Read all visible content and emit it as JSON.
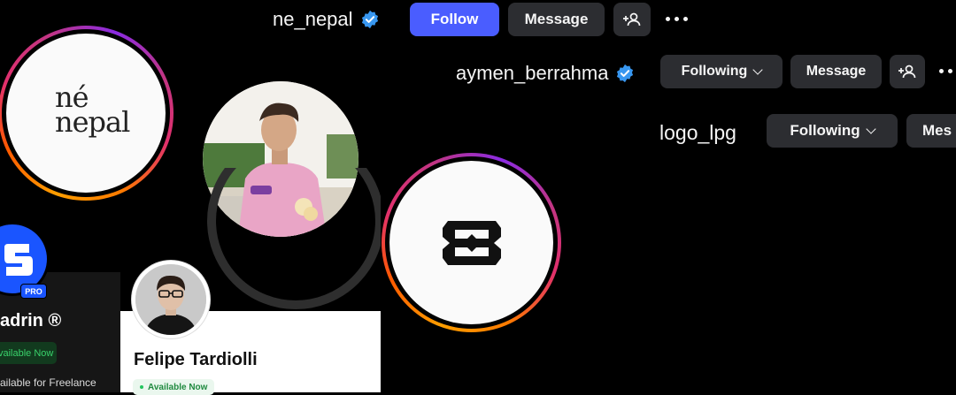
{
  "profile_ne_nepal": {
    "username": "ne_nepal",
    "follow_label": "Follow",
    "message_label": "Message",
    "logo_line1": "né",
    "logo_line2": "nepal"
  },
  "profile_aymen": {
    "username": "aymen_berrahma",
    "following_label": "Following",
    "message_label": "Message"
  },
  "profile_logo_lpg": {
    "username": "logo_lpg",
    "following_label": "Following",
    "message_label": "Mes"
  },
  "card_left": {
    "badge": "PRO",
    "name": "adrin ®",
    "status": "vailable Now",
    "freelance": "ailable for Freelance"
  },
  "card_felipe": {
    "name": "Felipe Tardiolli",
    "status": "Available Now"
  },
  "colors": {
    "follow_blue": "#4a5dff",
    "verified_blue": "#3897f0",
    "button_gray": "#2c2d31",
    "available_green": "#22c55e"
  },
  "icons": [
    "verified-badge-icon",
    "add-person-icon",
    "more-options-icon",
    "chevron-down-icon"
  ]
}
